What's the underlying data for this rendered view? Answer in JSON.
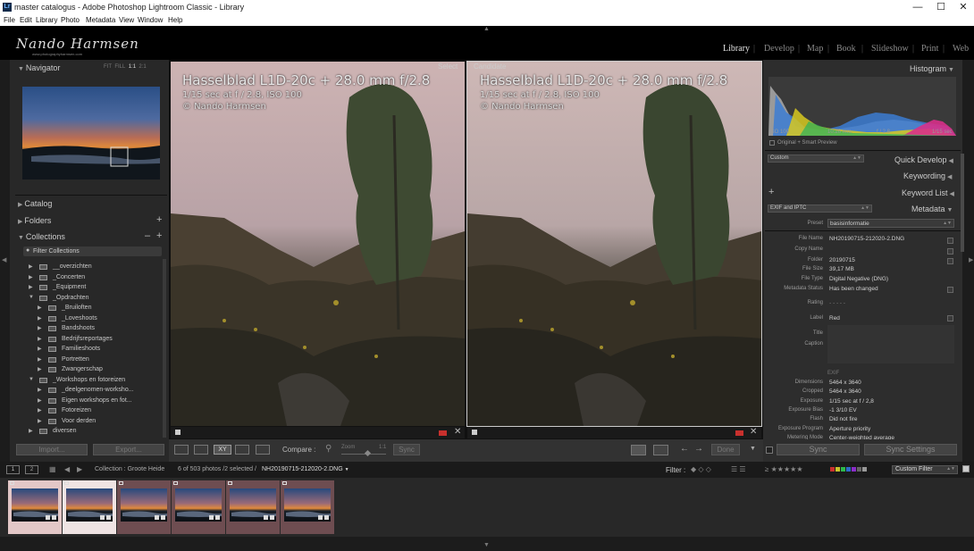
{
  "window": {
    "title": "master catalogus - Adobe Photoshop Lightroom Classic - Library",
    "app_icon": "Lr"
  },
  "menu": [
    "File",
    "Edit",
    "Library",
    "Photo",
    "Metadata",
    "View",
    "Window",
    "Help"
  ],
  "identity_plate": {
    "name": "Nando Harmsen",
    "sub": "www.photographyharmsen.com"
  },
  "modules": [
    "Library",
    "Develop",
    "Map",
    "Book",
    "Slideshow",
    "Print",
    "Web"
  ],
  "navigator": {
    "title": "Navigator",
    "zoom_options": [
      "FIT",
      "FILL",
      "1:1",
      "2:1"
    ]
  },
  "left_panels": {
    "catalog": "Catalog",
    "folders": "Folders",
    "collections": "Collections",
    "filter": "Filter Collections"
  },
  "collections": [
    {
      "name": "__overzichten",
      "depth": 1,
      "open": false
    },
    {
      "name": "_Concerten",
      "depth": 1,
      "open": false
    },
    {
      "name": "_Equipment",
      "depth": 1,
      "open": false
    },
    {
      "name": "_Opdrachten",
      "depth": 1,
      "open": true
    },
    {
      "name": "_Bruiloften",
      "depth": 2,
      "open": false
    },
    {
      "name": "_Loveshoots",
      "depth": 2,
      "open": false
    },
    {
      "name": "Bandshoots",
      "depth": 2,
      "open": false
    },
    {
      "name": "Bedrijfsreportages",
      "depth": 2,
      "open": false
    },
    {
      "name": "Familieshoots",
      "depth": 2,
      "open": false
    },
    {
      "name": "Portretten",
      "depth": 2,
      "open": false
    },
    {
      "name": "Zwangerschap",
      "depth": 2,
      "open": false
    },
    {
      "name": "_Workshops en fotoreizen",
      "depth": 1,
      "open": true
    },
    {
      "name": "_deelgenomen-worksho...",
      "depth": 2,
      "open": false
    },
    {
      "name": "Eigen workshops en fot...",
      "depth": 2,
      "open": false
    },
    {
      "name": "Fotoreizen",
      "depth": 2,
      "open": false
    },
    {
      "name": "Voor derden",
      "depth": 2,
      "open": false
    },
    {
      "name": "diversen",
      "depth": 1,
      "open": false
    }
  ],
  "left_buttons": {
    "import": "Import...",
    "export": "Export..."
  },
  "viewer": {
    "select": {
      "tag": "Select",
      "line1": "Hasselblad L1D-20c + 28.0 mm f/2.8",
      "line2": "1/15 sec at f / 2.8, ISO 100",
      "line3": "© Nando Harmsen"
    },
    "candidate": {
      "tag": "Candidate",
      "line1": "Hasselblad L1D-20c + 28.0 mm f/2.8",
      "line2": "1/15 sec at f / 2.8, ISO 100",
      "line3": "© Nando Harmsen"
    }
  },
  "toolbar": {
    "compare": "Compare :",
    "zoom": "Zoom",
    "ratio": "1:1",
    "sync": "Sync",
    "done": "Done",
    "xy": "XY"
  },
  "right_panels": {
    "histogram": "Histogram",
    "quick_develop": "Quick Develop",
    "keywording": "Keywording",
    "keyword_list": "Keyword List",
    "metadata": "Metadata"
  },
  "histogram": {
    "iso": "ISO 100",
    "focal": "10.26 mm",
    "aperture": "f / 2.8",
    "shutter": "1/15 sec",
    "preview": "Original + Smart Preview"
  },
  "quick_develop": {
    "preset": "Custom"
  },
  "metadata": {
    "set": "EXIF and IPTC",
    "preset_label": "Preset",
    "preset_value": "basisinformatie",
    "fields": [
      {
        "label": "File Name",
        "value": "NH20190715-212020-2.DNG"
      },
      {
        "label": "Copy Name",
        "value": ""
      },
      {
        "label": "Folder",
        "value": "20190715"
      },
      {
        "label": "File Size",
        "value": "39,17 MB"
      },
      {
        "label": "File Type",
        "value": "Digital Negative (DNG)"
      },
      {
        "label": "Metadata Status",
        "value": "Has been changed"
      },
      {
        "label": "Rating",
        "value": "· · · · ·"
      },
      {
        "label": "Label",
        "value": "Red"
      },
      {
        "label": "Title",
        "value": ""
      },
      {
        "label": "Caption",
        "value": ""
      }
    ],
    "exif_heading": "EXIF",
    "exif": [
      {
        "label": "Dimensions",
        "value": "5464 x 3640"
      },
      {
        "label": "Cropped",
        "value": "5464 x 3640"
      },
      {
        "label": "Exposure",
        "value": "1/15 sec at f / 2,8"
      },
      {
        "label": "Exposure Bias",
        "value": "-1 3/10 EV"
      },
      {
        "label": "Flash",
        "value": "Did not fire"
      },
      {
        "label": "Exposure Program",
        "value": "Aperture priority"
      },
      {
        "label": "Metering Mode",
        "value": "Center-weighted average"
      }
    ]
  },
  "right_buttons": {
    "sync": "Sync",
    "sync_settings": "Sync Settings"
  },
  "filmstrip": {
    "page1": "1",
    "page2": "2",
    "source": "Collection : Groote Heide",
    "count": "6 of 503 photos /2 selected /",
    "file": "NH20190715-212020-2.DNG",
    "filter_label": "Filter :",
    "custom_filter": "Custom Filter",
    "stars": "★★★★★",
    "thumb_count": 6
  },
  "colors": {
    "accent_red": "#c8302d",
    "panel": "#2d2d2d",
    "sky_orange": "#d07a3c"
  }
}
